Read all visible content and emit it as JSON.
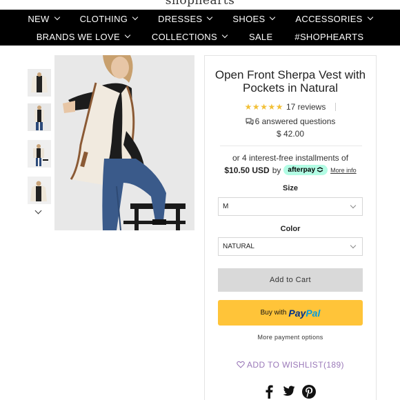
{
  "site": {
    "logo": "shophearts"
  },
  "nav": {
    "row1": [
      {
        "label": "NEW",
        "dropdown": true
      },
      {
        "label": "CLOTHING",
        "dropdown": true
      },
      {
        "label": "DRESSES",
        "dropdown": true
      },
      {
        "label": "SHOES",
        "dropdown": true
      },
      {
        "label": "ACCESSORIES",
        "dropdown": true
      }
    ],
    "row2": [
      {
        "label": "BRANDS WE LOVE",
        "dropdown": true
      },
      {
        "label": "COLLECTIONS",
        "dropdown": true
      },
      {
        "label": "SALE",
        "dropdown": false
      },
      {
        "label": "#SHOPHEARTS",
        "dropdown": false
      }
    ]
  },
  "gallery": {
    "thumbnail_count": 4,
    "next_icon": "chevron-down-icon"
  },
  "product": {
    "title": "Open Front Sherpa Vest with Pockets in Natural",
    "stars": "★★★★★",
    "rating": 5,
    "reviews": "17 reviews",
    "questions": "6 answered questions",
    "price": "$ 42.00"
  },
  "afterpay": {
    "line1": "or 4 interest-free installments of",
    "amount": "$10.50 USD",
    "by": "by",
    "badge": "afterpay",
    "more": "More info"
  },
  "options": {
    "size_label": "Size",
    "size_value": "M",
    "color_label": "Color",
    "color_value": "NATURAL"
  },
  "actions": {
    "add_to_cart": "Add to Cart",
    "buy_with": "Buy with",
    "paypal_pay": "Pay",
    "paypal_pal": "Pal",
    "more_payment": "More payment options",
    "wishlist": "ADD TO WISHLIST",
    "wishlist_count": "(189)"
  },
  "social": [
    "facebook-icon",
    "twitter-icon",
    "pinterest-icon"
  ],
  "colors": {
    "nav_bg": "#000000",
    "star": "#f2c037",
    "afterpay_badge": "#b2fce4",
    "paypal_button": "#ffc439",
    "paypal_dark": "#003087",
    "paypal_light": "#009cde",
    "wishlist": "#9a78b8",
    "cart_button": "#d9d9d9"
  }
}
